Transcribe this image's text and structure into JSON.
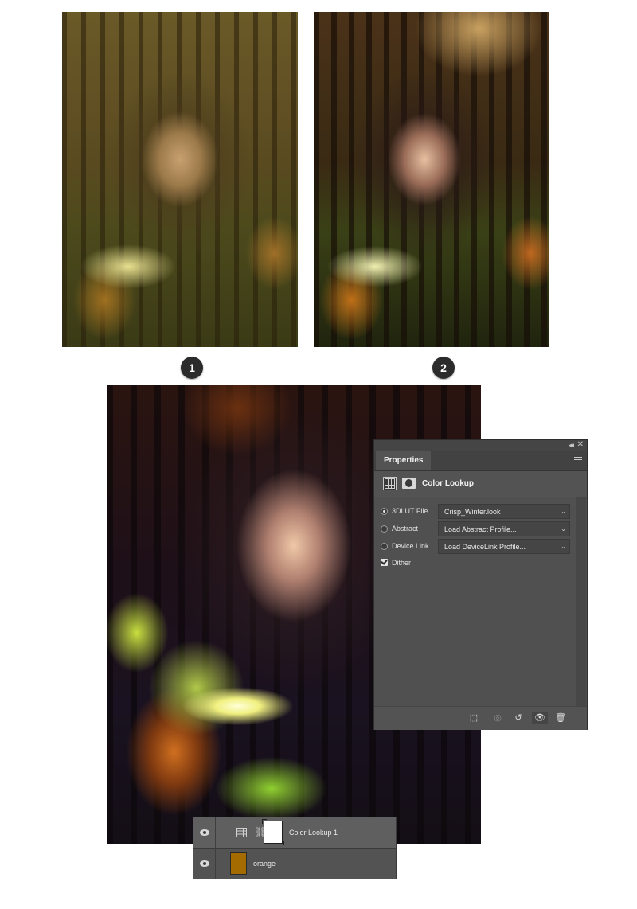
{
  "figure": {
    "step_badges": [
      "1",
      "2"
    ]
  },
  "properties_panel": {
    "tab_label": "Properties",
    "adjustment_title": "Color Lookup",
    "options": [
      {
        "label": "3DLUT File",
        "value": "Crisp_Winter.look",
        "selected": true
      },
      {
        "label": "Abstract",
        "value": "Load Abstract Profile...",
        "selected": false
      },
      {
        "label": "Device Link",
        "value": "Load DeviceLink Profile...",
        "selected": false
      }
    ],
    "dither": {
      "label": "Dither",
      "checked": true
    },
    "icons": {
      "collapse": "collapse-icon",
      "close": "close-icon",
      "menu": "panel-menu-icon",
      "footer": [
        "clip-to-layer-icon",
        "view-previous-icon",
        "reset-icon",
        "visibility-icon",
        "trash-icon"
      ]
    }
  },
  "layers_panel": {
    "layers": [
      {
        "name": "Color Lookup 1",
        "type": "adjustment",
        "visible": true
      },
      {
        "name": "orange",
        "type": "fill",
        "visible": true,
        "swatch_color": "#a36b00"
      }
    ]
  },
  "colors": {
    "panel_bg": "#535353",
    "panel_dark": "#424242",
    "text": "#dcdcdc",
    "orange_swatch": "#a36b00"
  }
}
